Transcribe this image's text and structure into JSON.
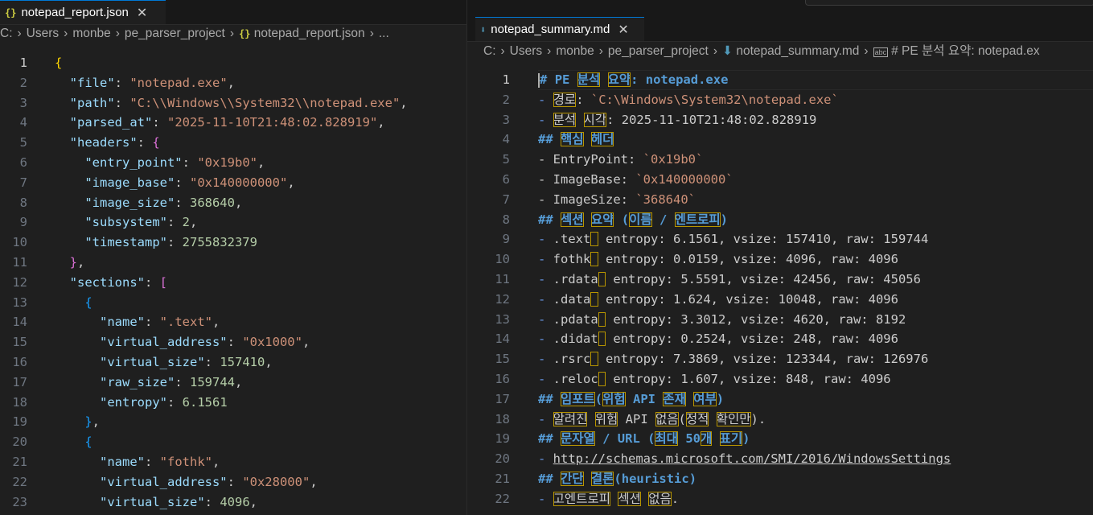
{
  "left_tab": {
    "icon": "{}",
    "title": "notepad_report.json",
    "close": "✕"
  },
  "right_tab": {
    "icon": "⬇",
    "title": "notepad_summary.md",
    "close": "✕"
  },
  "left_breadcrumb": [
    "C:",
    "Users",
    "monbe",
    "pe_parser_project",
    "notepad_report.json",
    "..."
  ],
  "right_breadcrumb": [
    "C:",
    "Users",
    "monbe",
    "pe_parser_project",
    "notepad_summary.md",
    "# PE 분석 요약: notepad.ex"
  ],
  "left_code": [
    {
      "n": "1"
    },
    {
      "n": "2"
    },
    {
      "n": "3"
    },
    {
      "n": "4"
    },
    {
      "n": "5"
    },
    {
      "n": "6"
    },
    {
      "n": "7"
    },
    {
      "n": "8"
    },
    {
      "n": "9"
    },
    {
      "n": "10"
    },
    {
      "n": "11"
    },
    {
      "n": "12"
    },
    {
      "n": "13"
    },
    {
      "n": "14"
    },
    {
      "n": "15"
    },
    {
      "n": "16"
    },
    {
      "n": "17"
    },
    {
      "n": "18"
    },
    {
      "n": "19"
    },
    {
      "n": "20"
    },
    {
      "n": "21"
    },
    {
      "n": "22"
    },
    {
      "n": "23"
    }
  ],
  "json": {
    "l1": "{",
    "k_file": "\"file\"",
    "v_file": "\"notepad.exe\"",
    "k_path": "\"path\"",
    "v_path": "\"C:\\\\Windows\\\\System32\\\\notepad.exe\"",
    "k_parsed": "\"parsed_at\"",
    "v_parsed": "\"2025-11-10T21:48:02.828919\"",
    "k_headers": "\"headers\"",
    "k_entry": "\"entry_point\"",
    "v_entry": "\"0x19b0\"",
    "k_ibase": "\"image_base\"",
    "v_ibase": "\"0x140000000\"",
    "k_isize": "\"image_size\"",
    "v_isize": "368640",
    "k_subsys": "\"subsystem\"",
    "v_subsys": "2",
    "k_ts": "\"timestamp\"",
    "v_ts": "2755832379",
    "k_sections": "\"sections\"",
    "k_name": "\"name\"",
    "v_name1": "\".text\"",
    "k_va": "\"virtual_address\"",
    "v_va1": "\"0x1000\"",
    "k_vs": "\"virtual_size\"",
    "v_vs1": "157410",
    "k_raw": "\"raw_size\"",
    "v_raw1": "159744",
    "k_ent": "\"entropy\"",
    "v_ent1": "6.1561",
    "v_name2": "\"fothk\"",
    "v_va2": "\"0x28000\"",
    "v_vs2": "4096"
  },
  "md": {
    "h1_hash": "#",
    "h1_w1": "PE",
    "h1_w2": "분석",
    "h1_w3": "요약",
    "h1_rest": ": notepad.exe",
    "l2_w1": "경로",
    "l2_code": "`C:\\Windows\\System32\\notepad.exe`",
    "l3_w1": "분석",
    "l3_w2": "시각",
    "l3_rest": ": 2025-11-10T21:48:02.828919",
    "h4_w1": "핵심",
    "h4_w2": "헤더",
    "l5_a": "- EntryPoint: ",
    "l5_code": "`0x19b0`",
    "l6_a": "- ImageBase: ",
    "l6_code": "`0x140000000`",
    "l7_a": "- ImageSize: ",
    "l7_code": "`368640`",
    "h8_w1": "섹션",
    "h8_w2": "요약",
    "h8_w3": "이름",
    "h8_w4": "엔트로피",
    "s9": ".text",
    "s9r": "entropy: 6.1561, vsize: 157410, raw: 159744",
    "s10": "fothk",
    "s10r": "entropy: 0.0159, vsize: 4096, raw: 4096",
    "s11": ".rdata",
    "s11r": "entropy: 5.5591, vsize: 42456, raw: 45056",
    "s12": ".data",
    "s12r": "entropy: 1.624, vsize: 10048, raw: 4096",
    "s13": ".pdata",
    "s13r": "entropy: 3.3012, vsize: 4620, raw: 8192",
    "s14": ".didat",
    "s14r": "entropy: 0.2524, vsize: 248, raw: 4096",
    "s15": ".rsrc",
    "s15r": "entropy: 7.3869, vsize: 123344, raw: 126976",
    "s16": ".reloc",
    "s16r": "entropy: 1.607, vsize: 848, raw: 4096",
    "h17_w1": "임포트",
    "h17_w2": "위험",
    "h17_api": "API",
    "h17_w3": "존재",
    "h17_w4": "여부",
    "l18_w1": "알려진",
    "l18_w2": "위험",
    "l18_api": "API",
    "l18_w3": "없음",
    "l18_w4": "정적",
    "l18_w5": "확인만",
    "h19_w1": "문자열",
    "h19_url": "URL",
    "h19_w2": "최대",
    "h19_50": "50",
    "h19_w3": "개",
    "h19_w4": "표기",
    "l20_link": "http://schemas.microsoft.com/SMI/2016/WindowsSettings",
    "h21_w1": "간단",
    "h21_w2": "결론",
    "h21_rest": "(heuristic)",
    "l22_w1": "고엔트로피",
    "l22_w2": "섹션",
    "l22_w3": "없음"
  },
  "colors": {
    "background": "#1f1f1f",
    "key": "#9cdcfe",
    "string": "#ce9178",
    "number": "#b5cea8",
    "heading": "#569cd6",
    "highlight_box": "#b89500"
  }
}
